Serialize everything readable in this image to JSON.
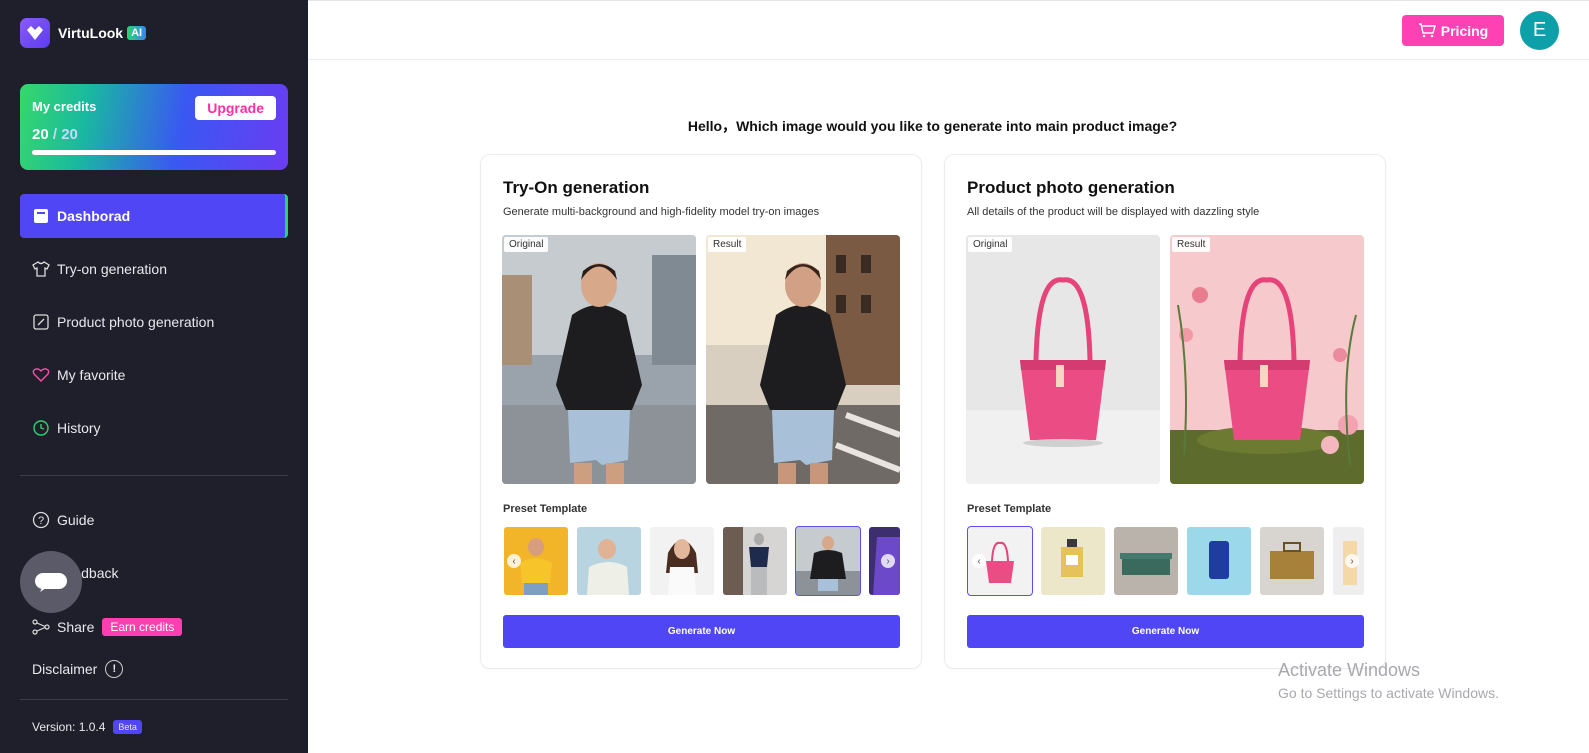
{
  "app": {
    "name": "VirtuLook",
    "badge": "AI"
  },
  "credits": {
    "title": "My credits",
    "used": "20",
    "total": "20",
    "upgrade_label": "Upgrade",
    "level": 1.0
  },
  "nav": {
    "dashboard": "Dashborad",
    "tryon": "Try-on generation",
    "product": "Product photo generation",
    "favorite": "My favorite",
    "history": "History",
    "guide": "Guide",
    "feedback": "Feedback",
    "share": "Share",
    "earn": "Earn credits",
    "disclaimer": "Disclaimer"
  },
  "version": {
    "label": "Version: 1.0.4",
    "badge": "Beta"
  },
  "header": {
    "pricing_label": "Pricing",
    "avatar_initial": "E"
  },
  "greeting": "Hello，Which image would you like to generate into main product image?",
  "cards": [
    {
      "title": "Try-On generation",
      "subtitle": "Generate multi-background and high-fidelity model try-on images",
      "original_label": "Original",
      "result_label": "Result",
      "preset_title": "Preset Template",
      "button_label": "Generate Now"
    },
    {
      "title": "Product photo generation",
      "subtitle": "All details of the product will be displayed with dazzling style",
      "original_label": "Original",
      "result_label": "Result",
      "preset_title": "Preset Template",
      "button_label": "Generate Now"
    }
  ],
  "watermark": {
    "line1": "Activate Windows",
    "line2": "Go to Settings to activate Windows."
  },
  "colors": {
    "accent": "#5046f5",
    "pink": "#ff41b4",
    "sidebar": "#1f1f2b",
    "avatar": "#0ea0a8"
  }
}
